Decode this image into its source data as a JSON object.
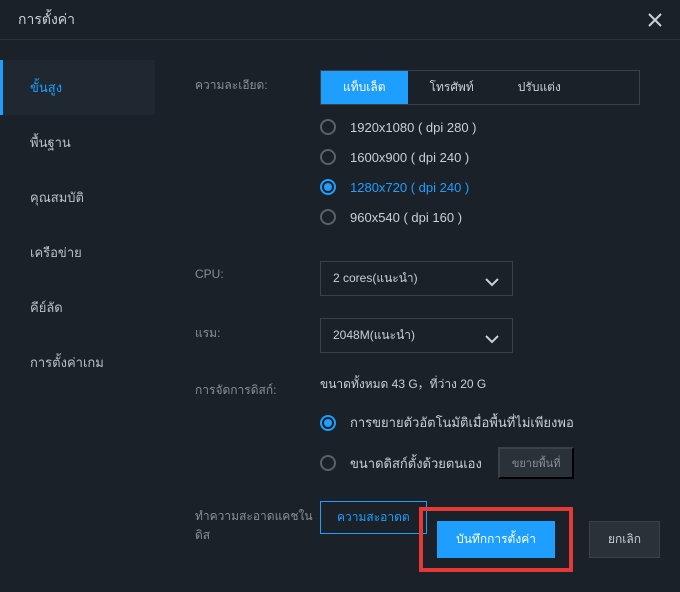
{
  "title": "การตั้งค่า",
  "sidebar": {
    "items": [
      {
        "label": "ขั้นสูง"
      },
      {
        "label": "พื้นฐาน"
      },
      {
        "label": "คุณสมบัติ"
      },
      {
        "label": "เครือข่าย"
      },
      {
        "label": "คีย์ลัด"
      },
      {
        "label": "การตั้งค่าเกม"
      }
    ]
  },
  "resolution": {
    "label": "ความละเอียด:",
    "tabs": [
      {
        "label": "แท็บเล็ต"
      },
      {
        "label": "โทรศัพท์"
      },
      {
        "label": "ปรับแต่ง"
      }
    ],
    "options": [
      {
        "label": "1920x1080 ( dpi 280 )"
      },
      {
        "label": "1600x900 ( dpi 240 )"
      },
      {
        "label": "1280x720 ( dpi 240 )"
      },
      {
        "label": "960x540 ( dpi 160 )"
      }
    ]
  },
  "cpu": {
    "label": "CPU:",
    "value": "2 cores(แนะนำ)"
  },
  "ram": {
    "label": "แรม:",
    "value": "2048M(แนะนำ)"
  },
  "disk": {
    "label": "การจัดการดิสก์:",
    "info": "ขนาดทั้งหมด 43 G，ที่ว่าง 20 G",
    "options": [
      {
        "label": "การขยายตัวอัตโนมัติเมื่อพื้นที่ไม่เพียงพอ"
      },
      {
        "label": "ขนาดดิสก์ตั้งด้วยตนเอง"
      }
    ],
    "extend_btn": "ขยายพื้นที่"
  },
  "cache": {
    "label": "ทำความสะอาดแคชในดิส",
    "btn": "ความสะอาดต"
  },
  "footer": {
    "save": "บันทึกการตั้งค่า",
    "cancel": "ยกเลิก"
  }
}
